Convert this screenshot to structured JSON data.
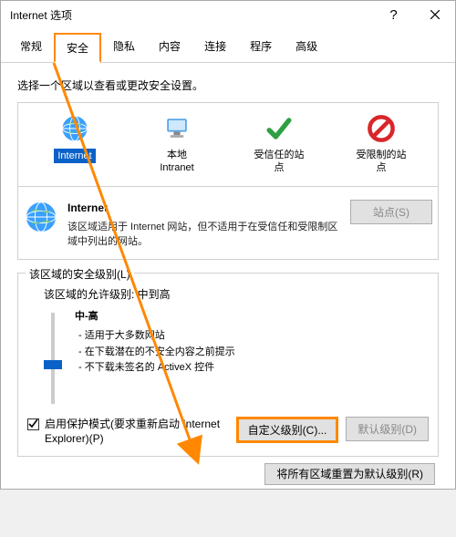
{
  "window": {
    "title": "Internet 选项"
  },
  "tabs": {
    "items": [
      {
        "label": "常规"
      },
      {
        "label": "安全"
      },
      {
        "label": "隐私"
      },
      {
        "label": "内容"
      },
      {
        "label": "连接"
      },
      {
        "label": "程序"
      },
      {
        "label": "高级"
      }
    ],
    "active_index": 1
  },
  "zone_select_label": "选择一个区域以查看或更改安全设置。",
  "zones": [
    {
      "caption": "Internet",
      "sub": ""
    },
    {
      "caption": "本地",
      "sub": "Intranet"
    },
    {
      "caption": "受信任的站",
      "sub": "点"
    },
    {
      "caption": "受限制的站",
      "sub": "点"
    }
  ],
  "selected_zone": {
    "title": "Internet",
    "desc": "该区域适用于 Internet 网站，但不适用于在受信任和受限制区域中列出的网站。"
  },
  "sites_button": "站点(S)",
  "security_groupbox": {
    "title": "该区域的安全级别(L)",
    "allowed_levels": "该区域的允许级别: 中到高",
    "level_name": "中-高",
    "bullets": [
      "- 适用于大多数网站",
      "- 在下载潜在的不安全内容之前提示",
      "- 不下载未签名的 ActiveX 控件"
    ],
    "protected_mode": "启用保护模式(要求重新启动 Internet Explorer)(P)",
    "custom_level_btn": "自定义级别(C)...",
    "default_level_btn": "默认级别(D)",
    "reset_btn": "将所有区域重置为默认级别(R)"
  },
  "colors": {
    "accent": "#ff8800",
    "select": "#0a62c9"
  }
}
